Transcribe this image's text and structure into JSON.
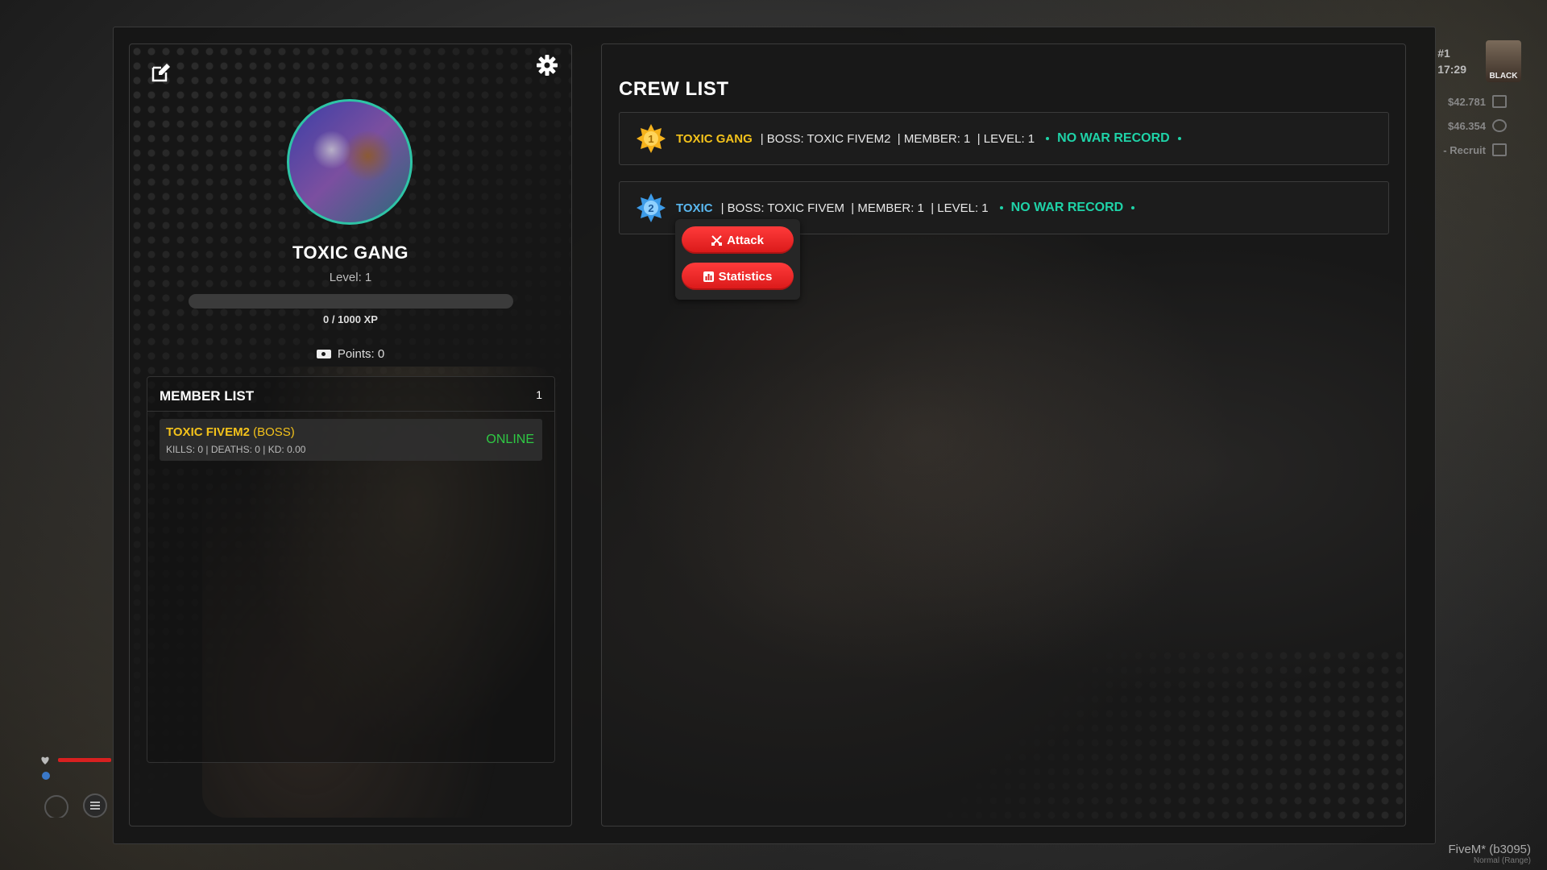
{
  "hud": {
    "rank": "#1",
    "time": "17:29",
    "avatar_label": "BLACK",
    "cash": "$42.781",
    "bank": "$46.354",
    "job": "- Recruit",
    "footer_app": "FiveM* (b3095)",
    "footer_sub": "Normal (Range)"
  },
  "profile": {
    "crew_name": "TOXIC GANG",
    "level_label": "Level: 1",
    "xp_text": "0 / 1000 XP",
    "xp_progress": 0,
    "points_label": "Points: 0",
    "icons": [
      "edit-icon",
      "gear-icon",
      "ticket-icon"
    ],
    "accent_color": "#2ec4a6"
  },
  "members": {
    "title": "MEMBER LIST",
    "count": "1",
    "rows": [
      {
        "name": "TOXIC FIVEM2",
        "role": " (BOSS)",
        "stats": "KILLS: 0 | DEATHS: 0 | KD: 0.00",
        "status": "ONLINE"
      }
    ]
  },
  "crew_list": {
    "title": "CREW LIST",
    "crews": [
      {
        "rank": "1",
        "name": "TOXIC GANG",
        "name_color": "#f3c21b",
        "info": "| BOSS: TOXIC FIVEM2  | MEMBER: 1  | LEVEL: 1",
        "war": "NO WAR RECORD"
      },
      {
        "rank": "2",
        "name": "TOXIC",
        "name_color": "#5ab8f0",
        "info": "| BOSS: TOXIC FIVEM  | MEMBER: 1  | LEVEL: 1",
        "war": "NO WAR RECORD"
      }
    ],
    "popup": {
      "attack_label": "Attack",
      "statistics_label": "Statistics"
    }
  }
}
